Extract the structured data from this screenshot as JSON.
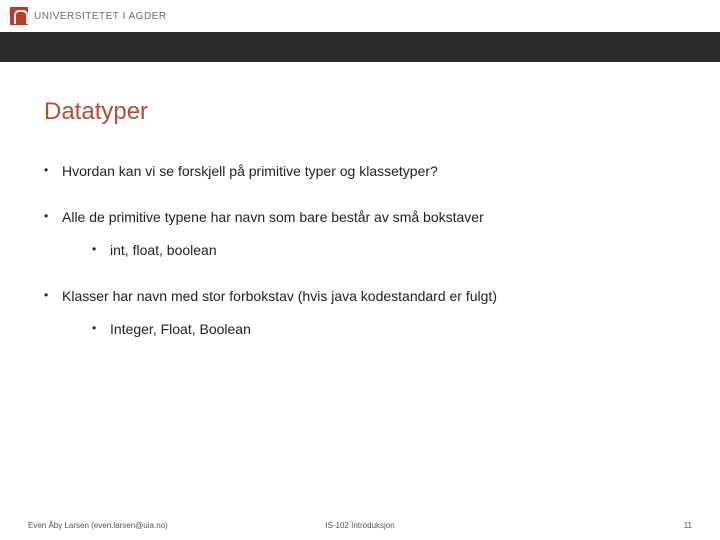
{
  "header": {
    "institution": "UNIVERSITETET I AGDER"
  },
  "title": "Datatyper",
  "bullets": [
    {
      "text": "Hvordan kan vi se forskjell på primitive typer og klassetyper?"
    },
    {
      "text": "Alle de primitive typene har navn som bare består av små bokstaver",
      "sub": [
        "int, float, boolean"
      ]
    },
    {
      "text": "Klasser har navn med stor forbokstav (hvis java kodestandard er fulgt)",
      "sub": [
        "Integer, Float, Boolean"
      ]
    }
  ],
  "footer": {
    "author": "Even Åby Larsen (even.larsen@uia.no)",
    "course": "IS-102 Introduksjon",
    "page": "11"
  }
}
